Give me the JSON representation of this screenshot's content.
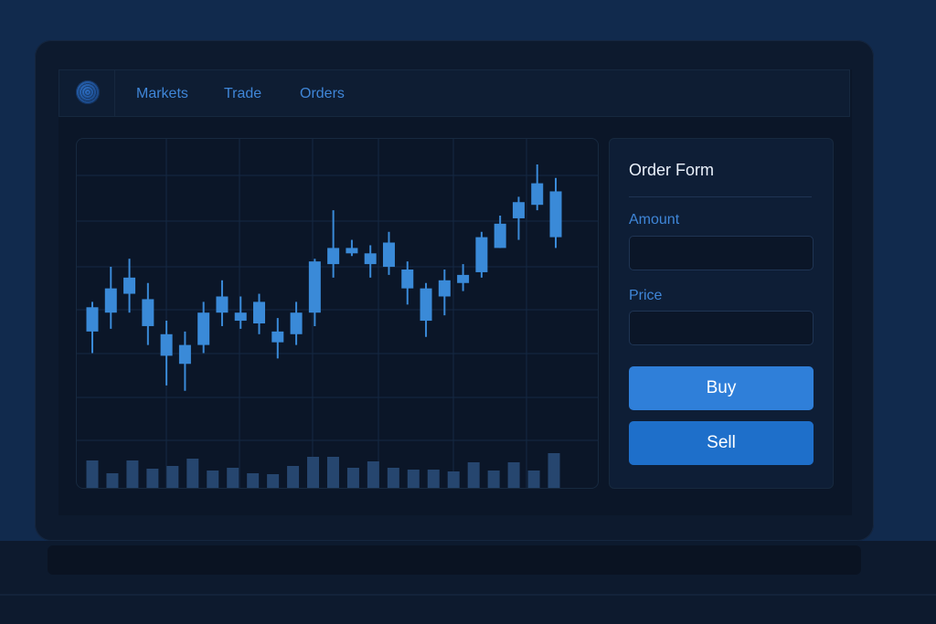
{
  "nav": {
    "items": [
      {
        "label": "Markets"
      },
      {
        "label": "Trade"
      },
      {
        "label": "Orders"
      }
    ]
  },
  "order_form": {
    "title": "Order Form",
    "amount_label": "Amount",
    "amount_value": "",
    "price_label": "Price",
    "price_value": "",
    "buy_label": "Buy",
    "sell_label": "Sell"
  },
  "colors": {
    "background": "#112a4d",
    "accent": "#3f86d8",
    "candle": "#3a8ad8",
    "volume": "#26466f",
    "buy": "#2f7fd9",
    "sell": "#1e6fca"
  },
  "chart_data": {
    "type": "candlestick",
    "title": "",
    "xlabel": "",
    "ylabel": "",
    "ylim": [
      0,
      100
    ],
    "grid": true,
    "candles": [
      {
        "o": 37,
        "h": 48,
        "l": 29,
        "c": 46
      },
      {
        "o": 44,
        "h": 61,
        "l": 38,
        "c": 53
      },
      {
        "o": 51,
        "h": 64,
        "l": 44,
        "c": 57
      },
      {
        "o": 49,
        "h": 55,
        "l": 32,
        "c": 39
      },
      {
        "o": 36,
        "h": 41,
        "l": 17,
        "c": 28
      },
      {
        "o": 25,
        "h": 37,
        "l": 15,
        "c": 32
      },
      {
        "o": 32,
        "h": 48,
        "l": 29,
        "c": 44
      },
      {
        "o": 44,
        "h": 56,
        "l": 39,
        "c": 50
      },
      {
        "o": 41,
        "h": 50,
        "l": 38,
        "c": 44
      },
      {
        "o": 40,
        "h": 51,
        "l": 36,
        "c": 48
      },
      {
        "o": 37,
        "h": 42,
        "l": 27,
        "c": 33
      },
      {
        "o": 36,
        "h": 48,
        "l": 32,
        "c": 44
      },
      {
        "o": 44,
        "h": 64,
        "l": 39,
        "c": 63
      },
      {
        "o": 62,
        "h": 82,
        "l": 57,
        "c": 68
      },
      {
        "o": 68,
        "h": 71,
        "l": 65,
        "c": 66
      },
      {
        "o": 62,
        "h": 69,
        "l": 57,
        "c": 66
      },
      {
        "o": 61,
        "h": 74,
        "l": 58,
        "c": 70
      },
      {
        "o": 60,
        "h": 63,
        "l": 47,
        "c": 53
      },
      {
        "o": 53,
        "h": 55,
        "l": 35,
        "c": 41
      },
      {
        "o": 50,
        "h": 60,
        "l": 43,
        "c": 56
      },
      {
        "o": 58,
        "h": 62,
        "l": 52,
        "c": 55
      },
      {
        "o": 59,
        "h": 74,
        "l": 57,
        "c": 72
      },
      {
        "o": 68,
        "h": 80,
        "l": 68,
        "c": 77
      },
      {
        "o": 79,
        "h": 87,
        "l": 71,
        "c": 85
      },
      {
        "o": 84,
        "h": 99,
        "l": 82,
        "c": 92
      },
      {
        "o": 89,
        "h": 94,
        "l": 68,
        "c": 72
      }
    ],
    "volume": [
      30,
      16,
      30,
      21,
      24,
      32,
      19,
      22,
      16,
      15,
      24,
      34,
      34,
      22,
      29,
      22,
      20,
      20,
      18,
      28,
      19,
      28,
      19,
      38
    ]
  }
}
